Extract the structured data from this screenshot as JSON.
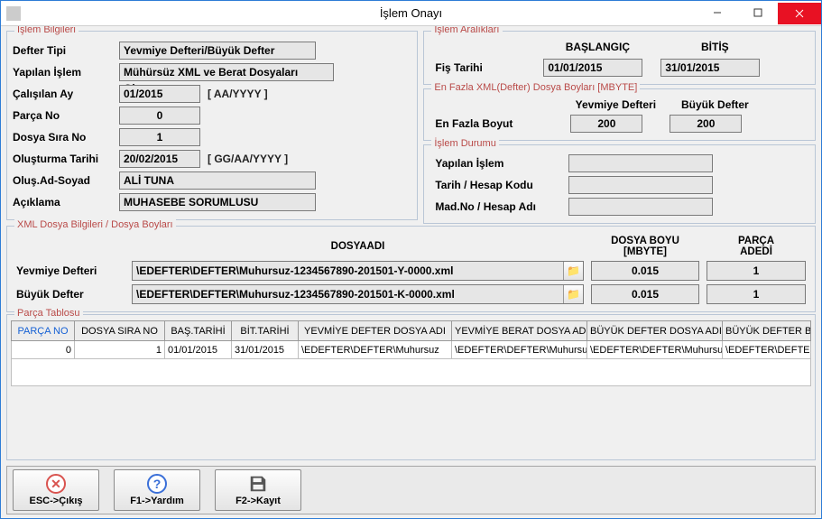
{
  "window": {
    "title": "İşlem Onayı"
  },
  "islem_bilgileri": {
    "legend": "İşlem Bilgileri",
    "defter_tipi_label": "Defter Tipi",
    "defter_tipi": "Yevmiye Defteri/Büyük Defter",
    "yapilan_islem_label": "Yapılan İşlem",
    "yapilan_islem": "Mühürsüz XML ve Berat Dosyaları Oluştur",
    "calisilan_ay_label": "Çalışılan Ay",
    "calisilan_ay": "01/2015",
    "calisilan_ay_hint": "[ AA/YYYY ]",
    "parca_no_label": "Parça No",
    "parca_no": "0",
    "dosya_sira_no_label": "Dosya Sıra No",
    "dosya_sira_no": "1",
    "olusturma_tarihi_label": "Oluşturma Tarihi",
    "olusturma_tarihi": "20/02/2015",
    "olusturma_tarihi_hint": "[ GG/AA/YYYY ]",
    "olus_ad_soyad_label": "Oluş.Ad-Soyad",
    "olus_ad_soyad": "ALİ TUNA",
    "aciklama_label": "Açıklama",
    "aciklama": "MUHASEBE SORUMLUSU"
  },
  "islem_araliklari": {
    "legend": "İşlem Aralıkları",
    "baslangic_header": "BAŞLANGIÇ",
    "bitis_header": "BİTİŞ",
    "fis_tarihi_label": "Fiş Tarihi",
    "fis_tarihi_baslangic": "01/01/2015",
    "fis_tarihi_bitis": "31/01/2015"
  },
  "en_fazla": {
    "legend": "En Fazla XML(Defter) Dosya Boyları  [MBYTE]",
    "yevmiye_header": "Yevmiye Defteri",
    "buyuk_header": "Büyük Defter",
    "en_fazla_label": "En Fazla Boyut",
    "yevmiye": "200",
    "buyuk": "200"
  },
  "islem_durumu": {
    "legend": "İşlem Durumu",
    "yapilan_islem_label": "Yapılan İşlem",
    "tarih_hesap_kodu_label": "Tarih / Hesap Kodu",
    "madno_hesap_adi_label": "Mad.No / Hesap Adı"
  },
  "xml_dosya": {
    "legend": "XML Dosya Bilgileri / Dosya Boyları",
    "dosya_adi_header": "DOSYAADI",
    "dosya_boyu_header": "DOSYA BOYU\n[MBYTE]",
    "parca_adedi_header": "PARÇA\nADEDİ",
    "yevmiye_label": "Yevmiye Defteri",
    "yevmiye_path": "\\EDEFTER\\DEFTER\\Muhursuz-1234567890-201501-Y-0000.xml",
    "yevmiye_boyut": "0.015",
    "yevmiye_parca": "1",
    "buyuk_label": "Büyük Defter",
    "buyuk_path": "\\EDEFTER\\DEFTER\\Muhursuz-1234567890-201501-K-0000.xml",
    "buyuk_boyut": "0.015",
    "buyuk_parca": "1"
  },
  "parca_tablosu": {
    "legend": "Parça Tablosu",
    "headers": {
      "parca_no": "PARÇA NO",
      "dosya_sira_no": "DOSYA SIRA NO",
      "bas_tarihi": "BAŞ.TARİHİ",
      "bit_tarihi": "BİT.TARİHİ",
      "yevmiye_dosya": "YEVMİYE DEFTER DOSYA ADI",
      "yevmiye_berat": "YEVMİYE BERAT DOSYA ADI",
      "buyuk_dosya": "BÜYÜK DEFTER DOSYA ADI",
      "buyuk_berat": "BÜYÜK DEFTER BERAT DOSYA ADI"
    },
    "rows": [
      {
        "parca_no": "0",
        "dosya_sira_no": "1",
        "bas_tarihi": "01/01/2015",
        "bit_tarihi": "31/01/2015",
        "yevmiye_dosya": "\\EDEFTER\\DEFTER\\Muhursuz",
        "yevmiye_berat": "\\EDEFTER\\DEFTER\\Muhursuz",
        "buyuk_dosya": "\\EDEFTER\\DEFTER\\Muhursuz",
        "buyuk_berat": "\\EDEFTER\\DEFTER\\Muhursuz"
      }
    ]
  },
  "toolbar": {
    "exit": "ESC->Çıkış",
    "help": "F1->Yardım",
    "save": "F2->Kayıt"
  }
}
